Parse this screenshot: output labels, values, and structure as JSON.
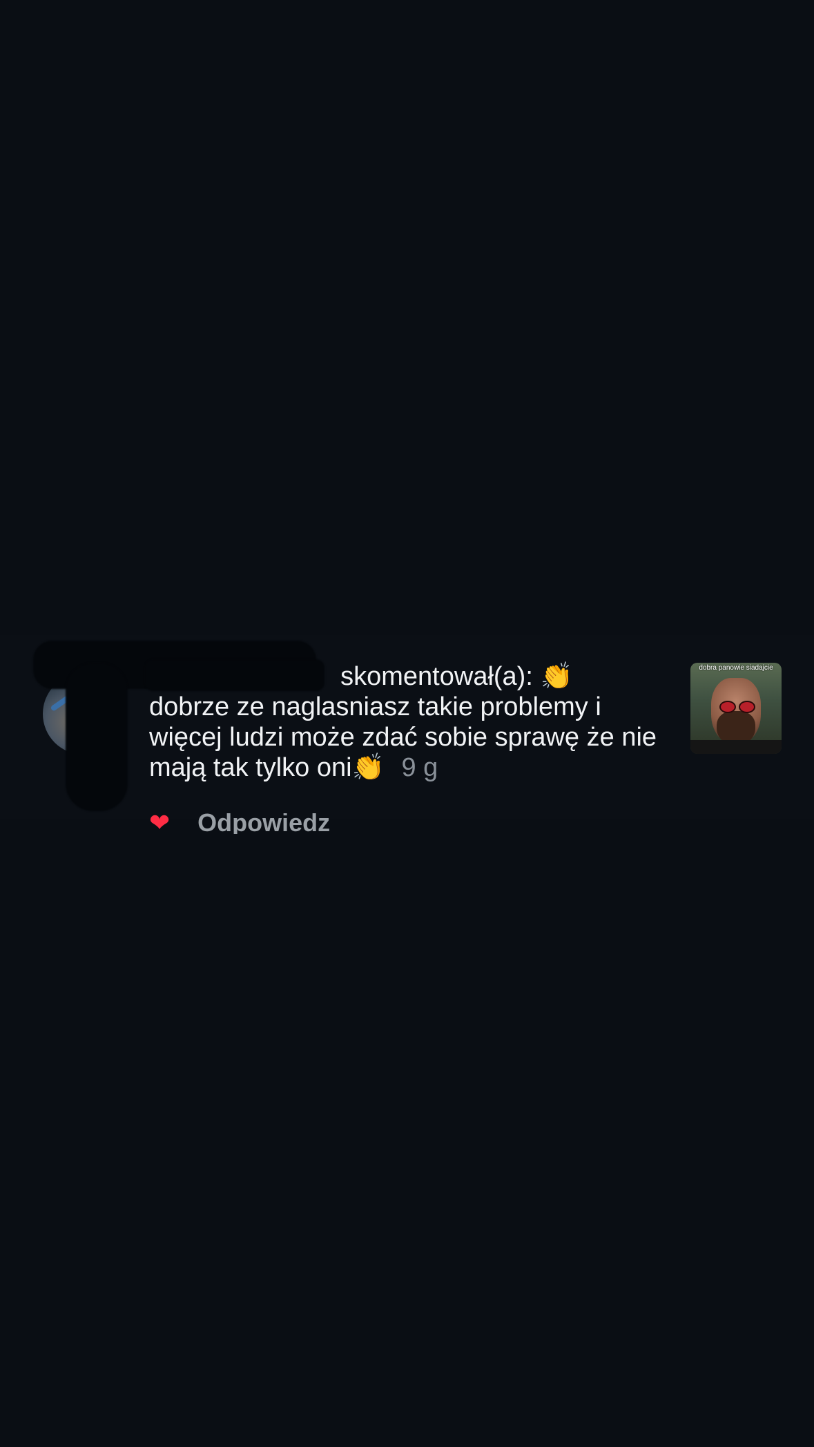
{
  "notification": {
    "action_text": "skomentował(a):",
    "emoji_1": "👏",
    "comment_text": "dobrze ze naglasniasz takie problemy i więcej ludzi może zdać sobie sprawę że nie mają tak tylko oni",
    "emoji_2": "👏",
    "time": "9 g",
    "reply_label": "Odpowiedz",
    "thumbnail_caption": "dobra panowie siadajcie"
  },
  "icons": {
    "like": "heart-icon"
  },
  "colors": {
    "background": "#0a0e14",
    "text": "#f1f3f5",
    "muted": "#8a9199",
    "like": "#ff2d45"
  }
}
